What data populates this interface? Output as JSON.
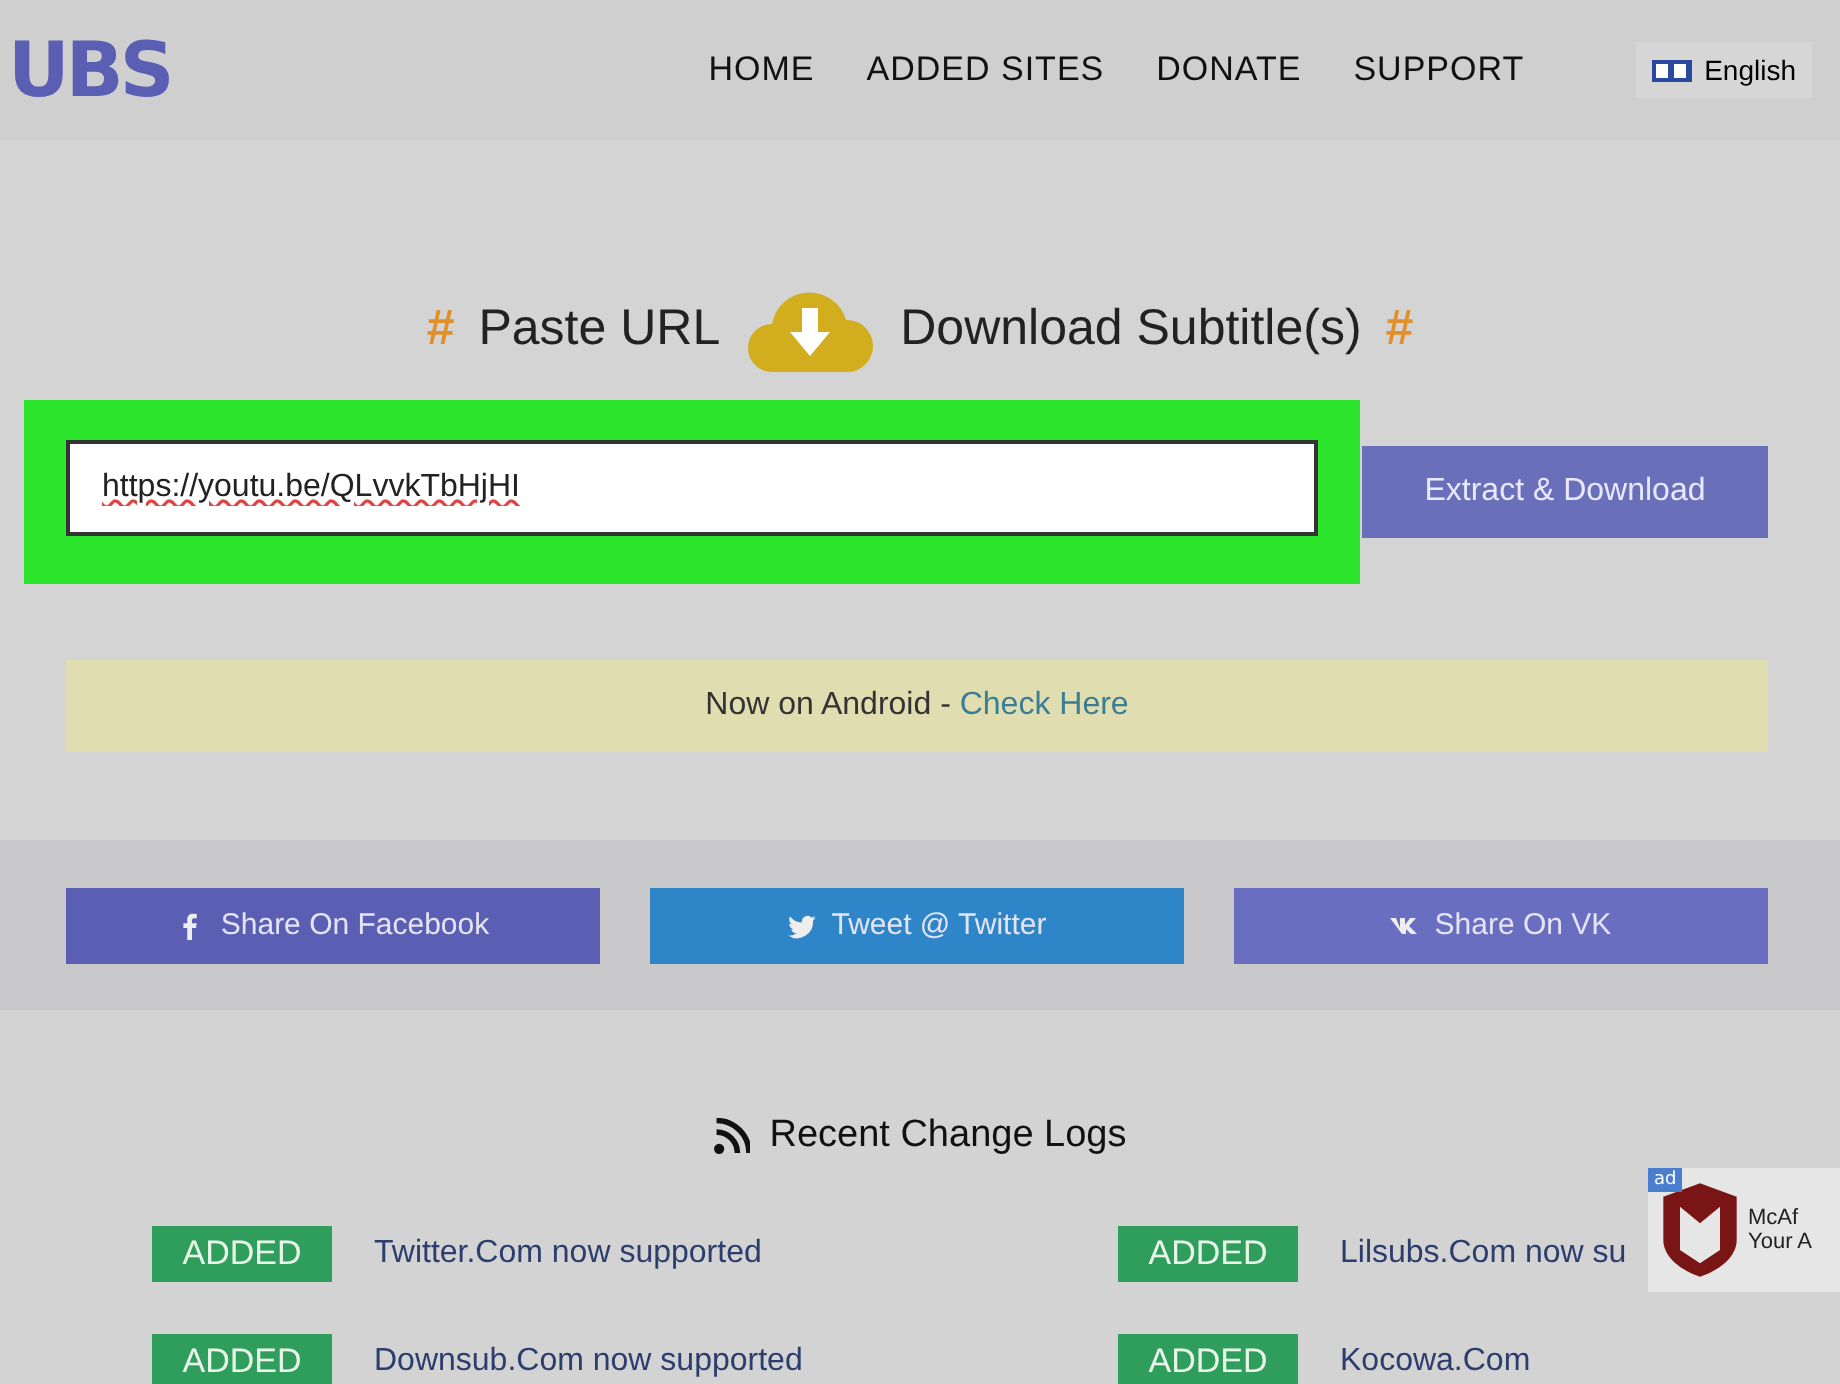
{
  "header": {
    "logo": "UBS",
    "nav": [
      {
        "label": "HOME"
      },
      {
        "label": "ADDED SITES"
      },
      {
        "label": "DONATE"
      },
      {
        "label": "SUPPORT"
      }
    ],
    "language": "English"
  },
  "hero": {
    "hash_left": "#",
    "title_left": "Paste URL",
    "title_right": "Download Subtitle(s)",
    "hash_right": "#"
  },
  "url_field": {
    "value": "https://youtu.be/QLvvkTbHjHI",
    "highlighted": true
  },
  "extract_button": "Extract & Download",
  "android_banner": {
    "text": "Now on Android - ",
    "link": "Check Here"
  },
  "share_buttons": [
    {
      "kind": "facebook",
      "label": "Share On Facebook",
      "color": "#5b5fb4"
    },
    {
      "kind": "twitter",
      "label": "Tweet @ Twitter",
      "color": "#2e86c9"
    },
    {
      "kind": "vk",
      "label": "Share On VK",
      "color": "#6a6ec0"
    }
  ],
  "changelog": {
    "title": "Recent Change Logs",
    "entries": [
      {
        "badge": "ADDED",
        "text": "Twitter.Com now supported"
      },
      {
        "badge": "ADDED",
        "text": "Lilsubs.Com now su"
      },
      {
        "badge": "ADDED",
        "text": "Downsub.Com now supported"
      },
      {
        "badge": "ADDED",
        "text": "Kocowa.Com"
      }
    ]
  },
  "ad_popup": {
    "tag": "ad",
    "title": "McAf",
    "subtitle": "Your A"
  }
}
